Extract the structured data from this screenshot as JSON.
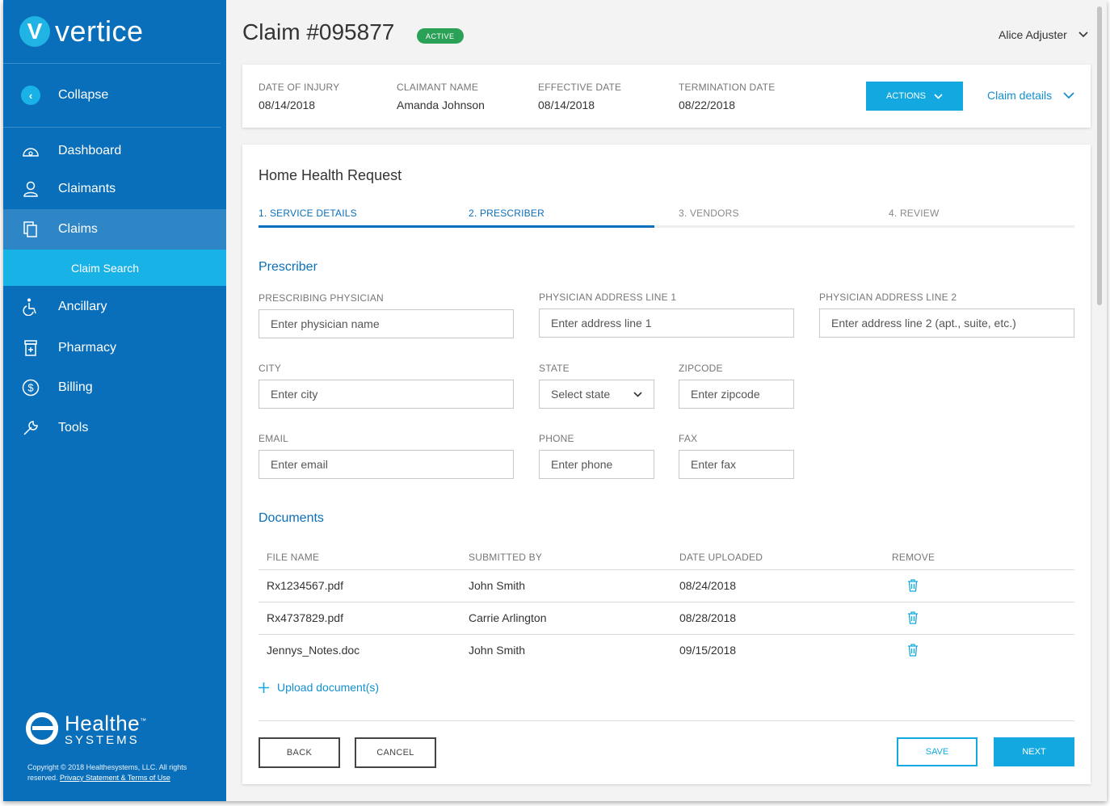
{
  "sidebar": {
    "logo_letter": "V",
    "logo_word": "vertice",
    "collapse_label": "Collapse",
    "items": [
      {
        "label": "Dashboard",
        "icon": "dashboard-icon"
      },
      {
        "label": "Claimants",
        "icon": "user-icon"
      },
      {
        "label": "Claims",
        "icon": "document-icon"
      },
      {
        "label": "Ancillary",
        "icon": "wheelchair-icon"
      },
      {
        "label": "Pharmacy",
        "icon": "pill-bottle-icon"
      },
      {
        "label": "Billing",
        "icon": "dollar-icon"
      },
      {
        "label": "Tools",
        "icon": "wrench-icon"
      }
    ],
    "sub_item": "Claim Search",
    "brand_line1": "Healthe",
    "brand_tm": "™",
    "brand_line2": "SYSTEMS",
    "copyright": "Copyright © 2018 Healthesystems, LLC. All rights reserved.",
    "privacy_link": "Privacy Statement & Terms of Use"
  },
  "header": {
    "title": "Claim #095877",
    "status": "ACTIVE",
    "user": "Alice Adjuster"
  },
  "summary": {
    "fields": [
      {
        "label": "DATE OF INJURY",
        "value": "08/14/2018"
      },
      {
        "label": "CLAIMANT NAME",
        "value": "Amanda Johnson"
      },
      {
        "label": "EFFECTIVE DATE",
        "value": "08/14/2018"
      },
      {
        "label": "TERMINATION DATE",
        "value": "08/22/2018"
      }
    ],
    "actions_label": "ACTIONS",
    "details_label": "Claim details"
  },
  "form": {
    "title": "Home Health Request",
    "steps": [
      "1. SERVICE DETAILS",
      "2. PRESCRIBER",
      "3. VENDORS",
      "4. REVIEW"
    ],
    "progress_fraction": 0.485,
    "section_title": "Prescriber",
    "fields": {
      "physician": {
        "label": "PRESCRIBING PHYSICIAN",
        "placeholder": "Enter physician name"
      },
      "address1": {
        "label": "PHYSICIAN ADDRESS LINE 1",
        "placeholder": "Enter address line 1"
      },
      "address2": {
        "label": "PHYSICIAN ADDRESS LINE 2",
        "placeholder": "Enter address line 2 (apt., suite, etc.)"
      },
      "city": {
        "label": "CITY",
        "placeholder": "Enter city"
      },
      "state": {
        "label": "STATE",
        "placeholder": "Select state"
      },
      "zip": {
        "label": "ZIPCODE",
        "placeholder": "Enter zipcode"
      },
      "email": {
        "label": "EMAIL",
        "placeholder": "Enter email"
      },
      "phone": {
        "label": "PHONE",
        "placeholder": "Enter phone"
      },
      "fax": {
        "label": "FAX",
        "placeholder": "Enter fax"
      }
    },
    "documents_title": "Documents",
    "table_headers": [
      "FILE NAME",
      "SUBMITTED BY",
      "DATE UPLOADED",
      "REMOVE"
    ],
    "documents": [
      {
        "file": "Rx1234567.pdf",
        "by": "John Smith",
        "date": "08/24/2018"
      },
      {
        "file": "Rx4737829.pdf",
        "by": "Carrie Arlington",
        "date": "08/28/2018"
      },
      {
        "file": "Jennys_Notes.doc",
        "by": "John Smith",
        "date": "09/15/2018"
      }
    ],
    "upload_label": "Upload document(s)",
    "buttons": {
      "back": "BACK",
      "cancel": "CANCEL",
      "save": "SAVE",
      "next": "NEXT"
    }
  },
  "colors": {
    "sidebar": "#0a6fba",
    "accent": "#13a9e0",
    "active_badge": "#2aa157"
  }
}
